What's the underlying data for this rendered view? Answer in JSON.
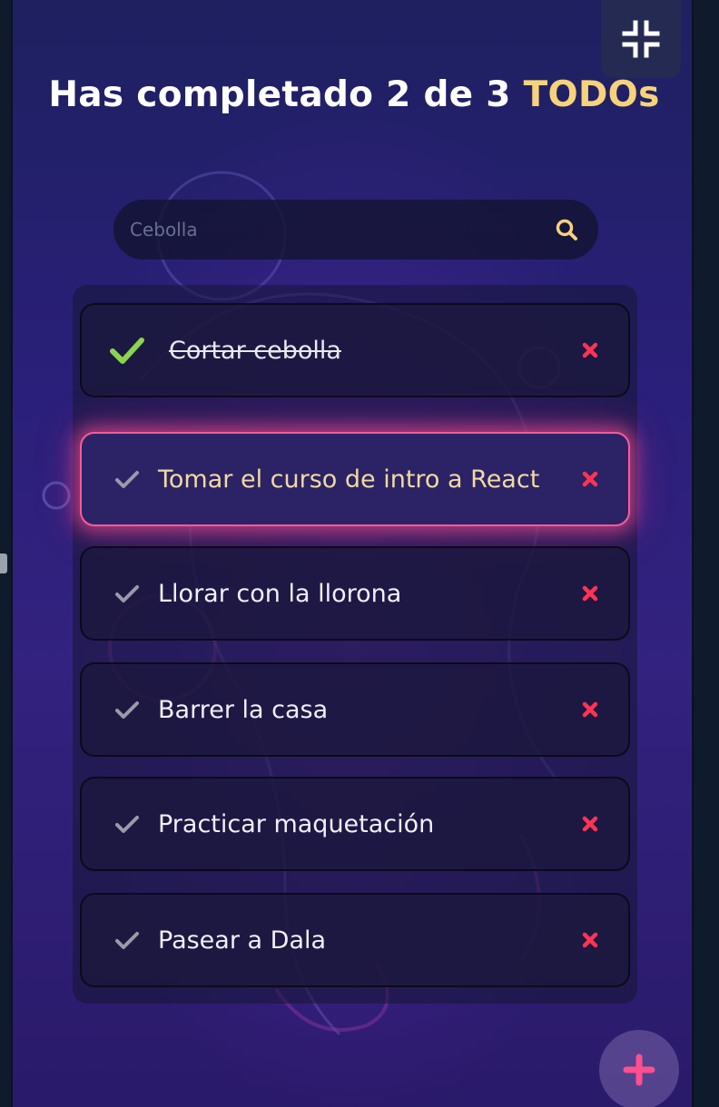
{
  "header": {
    "title_prefix": "Has completado 2 de 3 ",
    "title_accent": "TODOs",
    "collapse_icon": "collapse-icon"
  },
  "search": {
    "placeholder": "Cebolla",
    "icon": "search-icon"
  },
  "todos": [
    {
      "text": "Cortar cebolla",
      "completed": true,
      "active": false
    },
    {
      "text": "Tomar el curso de intro a React",
      "completed": false,
      "active": true
    },
    {
      "text": "Llorar con la llorona",
      "completed": false,
      "active": false
    },
    {
      "text": "Barrer la casa",
      "completed": false,
      "active": false
    },
    {
      "text": "Practicar maquetación",
      "completed": false,
      "active": false
    },
    {
      "text": "Pasear a Dala",
      "completed": false,
      "active": false
    }
  ],
  "colors": {
    "accent": "#f6d27a",
    "check_done": "#8bd44f",
    "check_pending": "#9a9aa8",
    "delete": "#ff3355",
    "highlight": "#ff5a9a",
    "add": "#ff4f8f"
  },
  "add_button_icon": "plus-icon"
}
